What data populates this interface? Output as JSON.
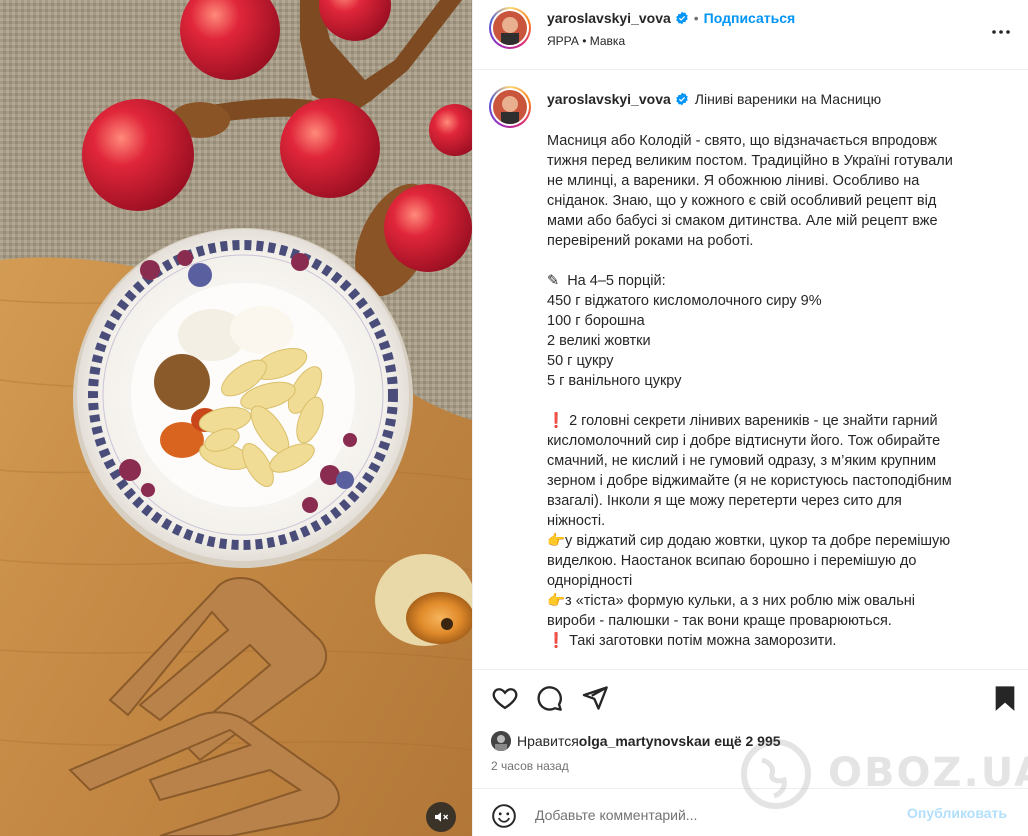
{
  "post": {
    "username": "yaroslavskyi_vova",
    "follow_label": "Подписаться",
    "location": "ЯРРА • Мавка",
    "time_ago": "2 часов назад"
  },
  "caption": {
    "title": "Ліниві  вареники на Масницю",
    "lines": [
      "Масниця або Колодій - свято, що відзначається впродовж",
      "тижня перед великим постом. Традиційно в Україні готували",
      "не млинці, а вареники. Я обожнюю ліниві. Особливо на",
      "сніданок. Знаю, що у кожного є свій особливий рецепт від",
      "мами або бабусі зі смаком дитинства. Але мій рецепт вже",
      "перевірений роками на роботі.",
      "",
      "✎  На 4–5 порцій:",
      "450 г віджатого кисломолочного сиру 9%",
      "100 г борошна",
      "2 великі жовтки",
      "50 г цукру",
      "5 г ванільного цукру",
      "",
      "❗ 2 головні секрети лінивих вареників - це знайти гарний",
      "кисломолочний сир і добре відтиснути його. Тож обирайте",
      "смачний, не кислий і не гумовий одразу, з м’яким крупним",
      "зерном і добре віджимайте (я не користуюсь пастоподібним",
      "взагалі). Інколи я ще можу перетерти через сито для",
      "ніжності.",
      "👉у віджатий сир додаю жовтки, цукор та добре перемішую",
      "виделкою. Наостанок всипаю борошно і перемішую до",
      "однорідності",
      "👉з «тіста» формую кульки, а з них роблю між овальні",
      "вироби - палюшки - так вони краще проварюються.",
      "❗ Такі заготовки потім можна заморозити."
    ]
  },
  "likes": {
    "prefix": "Нравится ",
    "user": "olga_martynovska",
    "suffix": " и ещё 2 995"
  },
  "comment": {
    "placeholder": "Добавьте комментарий...",
    "post_label": "Опубликовать"
  },
  "watermark": {
    "text": "OBOZ.UA"
  },
  "colors": {
    "accent": "#0095f6",
    "post_disabled": "#b2dffc",
    "muted": "#737373"
  }
}
